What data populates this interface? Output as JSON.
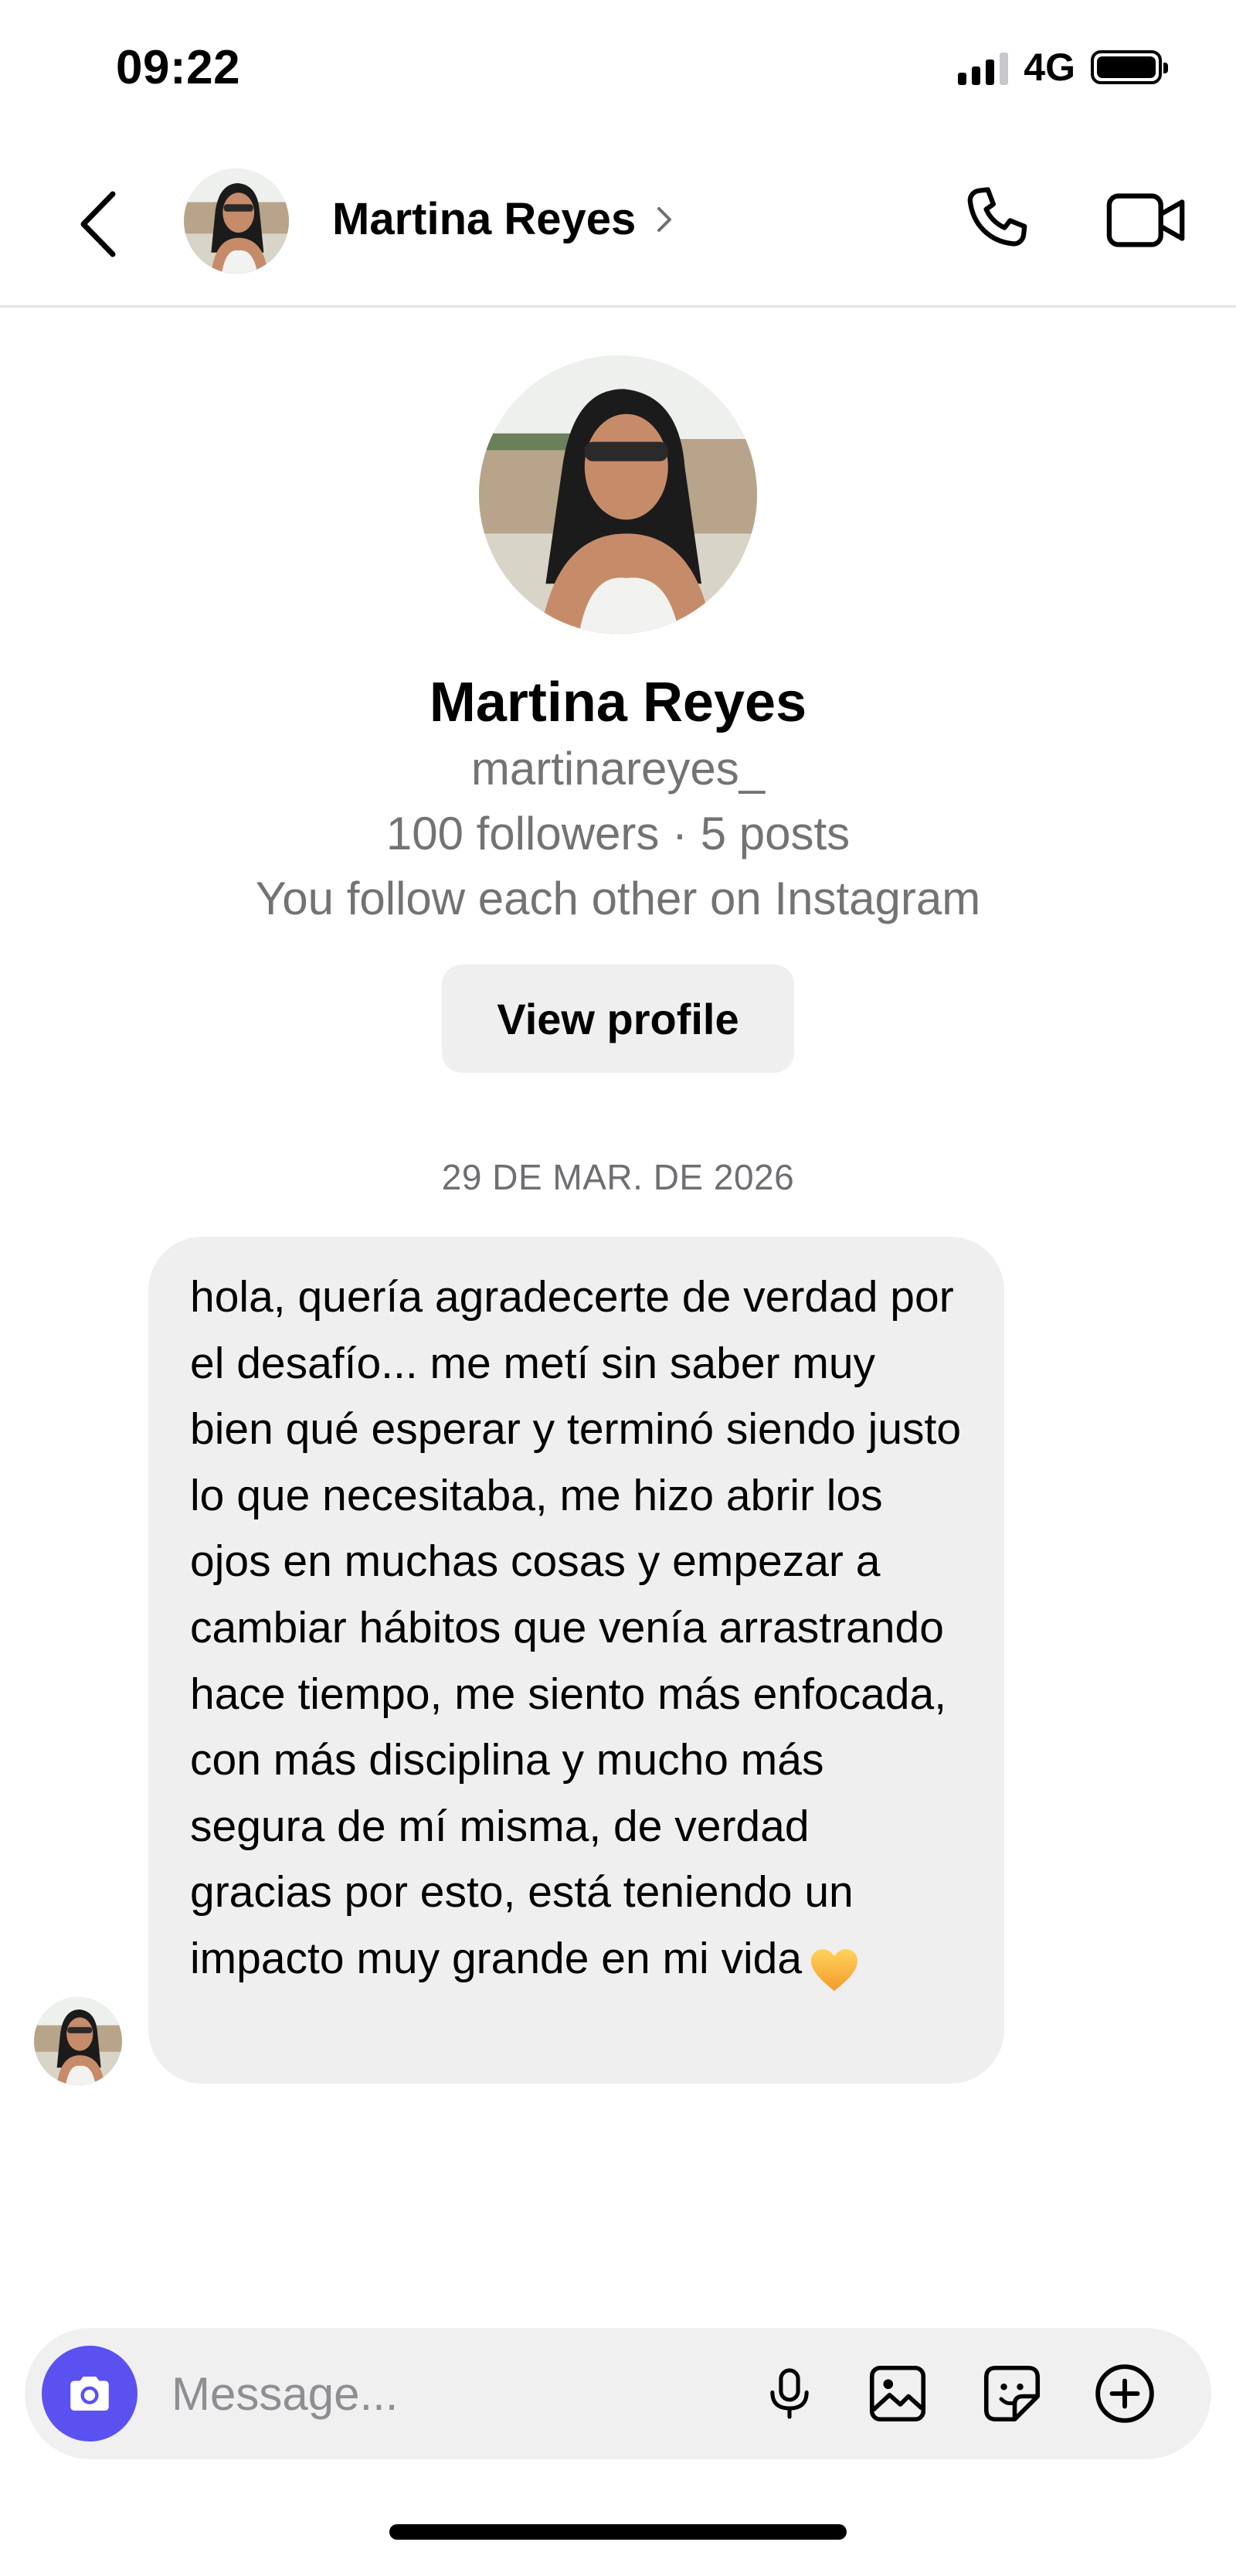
{
  "status_bar": {
    "time": "09:22",
    "network": "4G"
  },
  "header": {
    "contact_name": "Martina Reyes",
    "icons": [
      "back-icon",
      "chevron-right-icon",
      "phone-icon",
      "video-camera-icon"
    ]
  },
  "profile": {
    "name": "Martina Reyes",
    "username": "martinareyes_",
    "stats": "100 followers · 5 posts",
    "mutual": "You follow each other on Instagram",
    "view_profile_label": "View profile"
  },
  "conversation": {
    "date_separator": "29 DE MAR. DE 2026",
    "messages": [
      {
        "sender": "Martina Reyes",
        "text": "hola, quería agradecerte de verdad por el desafío... me metí sin saber muy bien qué esperar y terminó siendo justo lo que necesitaba, me hizo abrir los ojos en muchas cosas y empezar a cambiar hábitos que venía arrastrando hace tiempo, me siento más enfocada, con más disciplina y mucho más segura de mí misma, de verdad gracias por esto, está teniendo un impacto muy grande en mi vida",
        "emoji": "yellow-heart-icon"
      }
    ]
  },
  "composer": {
    "placeholder": "Message...",
    "icons": [
      "camera-icon",
      "microphone-icon",
      "gallery-icon",
      "sticker-icon",
      "plus-icon"
    ]
  },
  "colors": {
    "camera_button": "#5b51f0",
    "bubble": "#efefef",
    "secondary_text": "#737373",
    "heart": "#f5b53a"
  }
}
